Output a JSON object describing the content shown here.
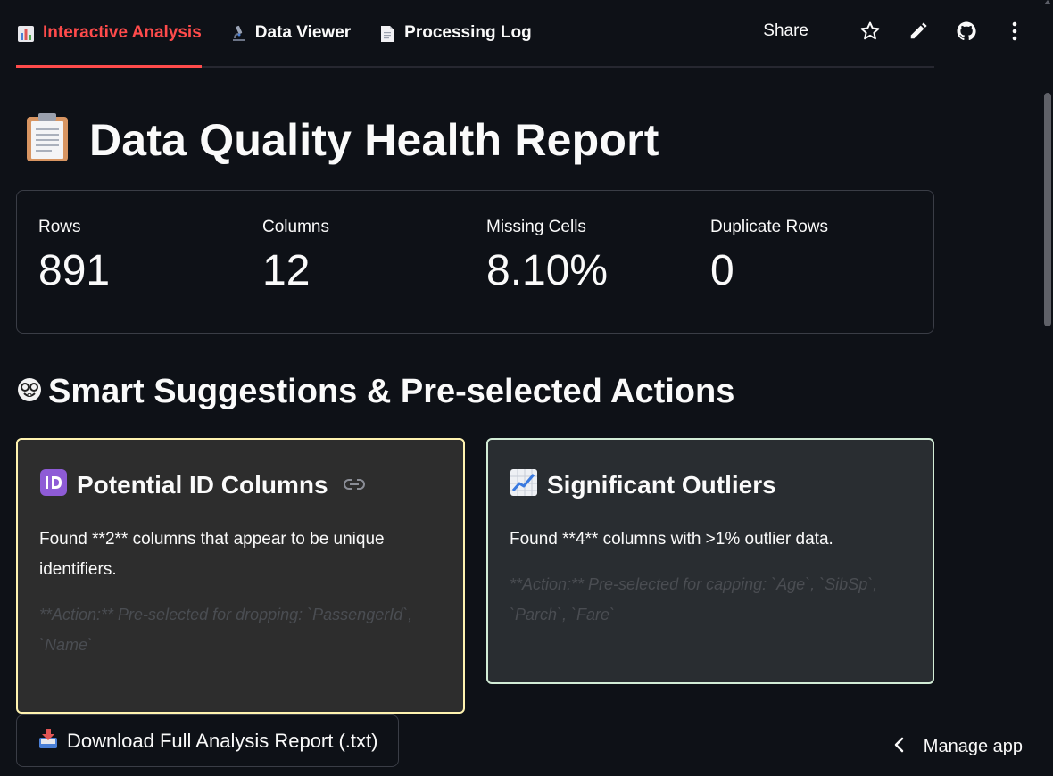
{
  "tabs": [
    {
      "label": "Interactive Analysis",
      "active": true,
      "icon": "bar-chart-icon"
    },
    {
      "label": "Data Viewer",
      "active": false,
      "icon": "microscope-icon"
    },
    {
      "label": "Processing Log",
      "active": false,
      "icon": "document-icon"
    }
  ],
  "toolbar": {
    "share_label": "Share",
    "icons": [
      "star-icon",
      "pencil-icon",
      "github-icon",
      "more-vertical-icon"
    ]
  },
  "title": {
    "text": "Data Quality Health Report",
    "icon": "clipboard-icon"
  },
  "metrics": [
    {
      "label": "Rows",
      "value": "891"
    },
    {
      "label": "Columns",
      "value": "12"
    },
    {
      "label": "Missing Cells",
      "value": "8.10%"
    },
    {
      "label": "Duplicate Rows",
      "value": "0"
    }
  ],
  "suggestions": {
    "heading": "Smart Suggestions & Pre-selected Actions",
    "heading_icon": "nerd-face-icon",
    "id_card": {
      "icon": "id-icon",
      "title": "Potential ID Columns",
      "body": "Found **2** columns that appear to be unique identifiers.",
      "action": "**Action:** Pre-selected for dropping: `PassengerId`, `Name`",
      "accent": "#fff3b0"
    },
    "outlier_card": {
      "icon": "chart-increasing-icon",
      "title": "Significant Outliers",
      "body": "Found **4** columns with >1% outlier data.",
      "action": "**Action:** Pre-selected for capping: `Age`, `SibSp`, `Parch`, `Fare`",
      "accent": "#d2ecd6"
    }
  },
  "download_button": {
    "label": "Download Full Analysis Report (.txt)",
    "icon": "inbox-tray-icon"
  },
  "manage_app": {
    "label": "Manage app"
  },
  "colors": {
    "background": "#0e1117",
    "accent": "#ff4b4b",
    "text": "#fafafa"
  }
}
